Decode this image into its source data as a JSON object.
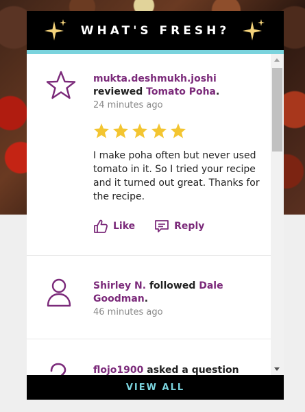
{
  "widget": {
    "title": "WHAT'S FRESH?",
    "view_all_label": "VIEW ALL"
  },
  "feed": [
    {
      "user": "mukta.deshmukh.joshi",
      "action": "reviewed",
      "target": "Tomato Poha",
      "punct": ".",
      "time": "24 minutes ago",
      "rating": 5,
      "review": "I make poha often but never used tomato in it. So I tried your recipe and it turned out great. Thanks for the recipe.",
      "like_label": "Like",
      "reply_label": "Reply",
      "icon": "star-outline-icon"
    },
    {
      "user": "Shirley N.",
      "action": "followed",
      "target": "Dale Goodman",
      "punct": ".",
      "time": "46 minutes ago",
      "icon": "person-outline-icon"
    },
    {
      "user": "flojo1900",
      "action": "asked a question",
      "icon": "question-mark-icon"
    }
  ],
  "colors": {
    "accent": "#7b2a7a",
    "teal": "#7ad3dd",
    "star": "#f3c531",
    "header_bg": "#000000"
  }
}
